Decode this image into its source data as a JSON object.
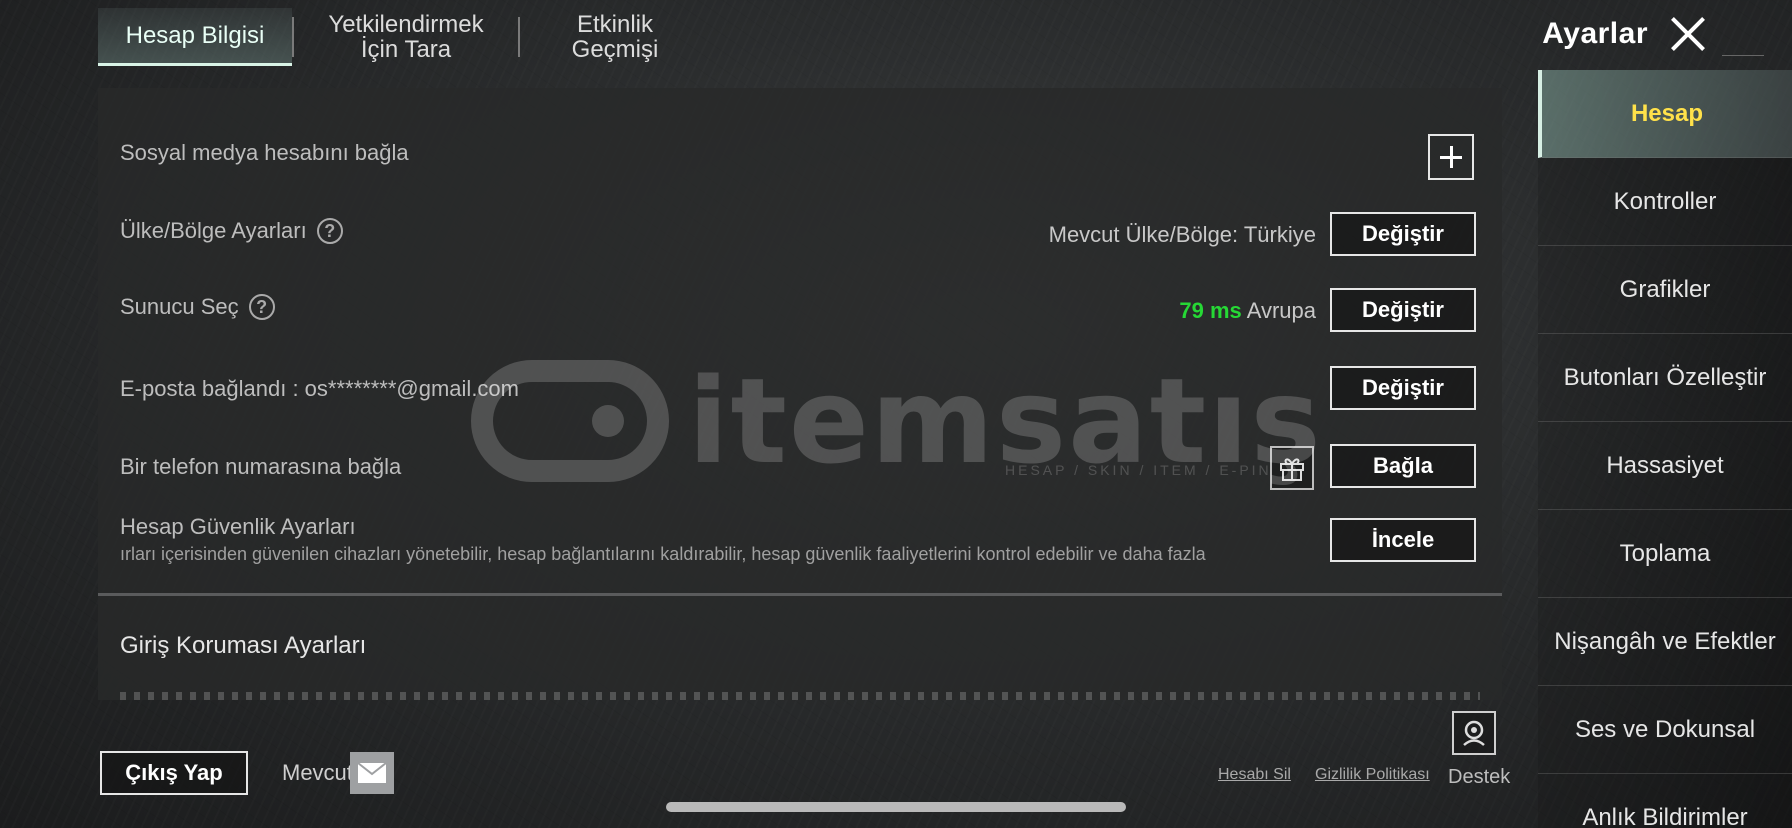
{
  "tabs": [
    {
      "label": "Hesap Bilgisi",
      "active": true
    },
    {
      "label": "Yetkilendirmek İçin Tara",
      "active": false
    },
    {
      "label": "Etkinlik Geçmişi",
      "active": false
    }
  ],
  "header": {
    "title": "Ayarlar"
  },
  "rows": {
    "social": {
      "label": "Sosyal medya hesabını bağla"
    },
    "region": {
      "label": "Ülke/Bölge Ayarları",
      "current": "Mevcut Ülke/Bölge: Türkiye",
      "button": "Değiştir"
    },
    "server": {
      "label": "Sunucu Seç",
      "ping": "79 ms",
      "region": "Avrupa",
      "button": "Değiştir"
    },
    "email": {
      "label": "E-posta bağlandı : os********@gmail.com",
      "button": "Değiştir"
    },
    "phone": {
      "label": "Bir telefon numarasına bağla",
      "button": "Bağla"
    },
    "security": {
      "label": "Hesap Güvenlik Ayarları",
      "desc": "ırları içerisinden güvenilen cihazları yönetebilir, hesap bağlantılarını kaldırabilir, hesap güvenlik faaliyetlerini kontrol edebilir ve daha fazla",
      "button": "İncele"
    }
  },
  "section": {
    "title": "Giriş Koruması Ayarları"
  },
  "watermark": {
    "text": "itemsatış",
    "sub": "HESAP / SKIN / ITEM / E-PIN"
  },
  "sidebar": {
    "items": [
      {
        "label": "Hesap",
        "active": true
      },
      {
        "label": "Kontroller"
      },
      {
        "label": "Grafikler"
      },
      {
        "label": "Butonları Özelleştir"
      },
      {
        "label": "Hassasiyet"
      },
      {
        "label": "Toplama"
      },
      {
        "label": "Nişangâh ve Efektler"
      },
      {
        "label": "Ses ve Dokunsal"
      },
      {
        "label": "Anlık Bildirimler"
      }
    ]
  },
  "footer": {
    "logout": "Çıkış Yap",
    "available": "Mevcut",
    "delete_account": "Hesabı Sil",
    "privacy": "Gizlilik Politikası",
    "support": "Destek"
  },
  "colors": {
    "ping": "#26d835",
    "active_side": "#ffe14a"
  },
  "icons": [
    "close-icon",
    "plus-icon",
    "help-icon",
    "gift-icon",
    "mail-icon",
    "support-icon"
  ]
}
